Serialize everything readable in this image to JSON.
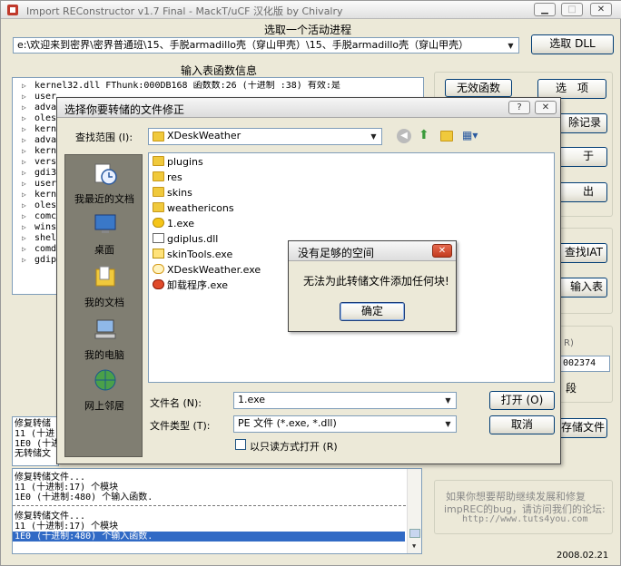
{
  "app": {
    "title": "Import REConstructor v1.7 Final - MackT/uCF 汉化版 by Chivalry",
    "process_label": "选取一个活动进程",
    "process_value": "e:\\欢迎来到密界\\密界普通班\\15、手脱armadillo壳（穿山甲壳）\\15、手脱armadillo壳（穿山甲壳）",
    "select_dll_label": "选取 DLL",
    "imports_label": "输入表函数信息",
    "tree_items": [
      "kernel32.dll FThunk:000DB168 函数数:26 (十进制 :38) 有效:是",
      "user",
      "adva",
      "oles",
      "kern",
      "adva",
      "kern",
      "vers",
      "gdi3",
      "user",
      "kern",
      "oles",
      "comc",
      "wins",
      "shel",
      "comd",
      "gdip"
    ],
    "right_buttons": [
      "无效函数",
      "选　项",
      "除记录",
      "于",
      "出",
      "查找IAT",
      "输入表",
      "存储文件"
    ],
    "side_text_1": "R)",
    "side_value": "002374",
    "side_text_2": "段",
    "log_top": [
      "修复转储",
      "11 (十进",
      "1E0 (十进",
      "无转储文"
    ],
    "log_bottom": [
      "修复转储文件...",
      "11 (十进制:17) 个模块",
      "1E0 (十进制:480) 个输入函数.",
      "",
      "修复转储文件...",
      "11 (十进制:17) 个模块",
      "1E0 (十进制:480) 个输入函数."
    ],
    "footer_text_1": "如果你想要帮助继续发展和修复",
    "footer_text_2": "impREC的bug，请访问我们的论坛:",
    "footer_url": "http://www.tuts4you.com",
    "date": "2008.02.21"
  },
  "dialog": {
    "title": "选择你要转储的文件修正",
    "lookin_label": "查找范围 (I):",
    "lookin_value": "XDeskWeather",
    "places": [
      "我最近的文档",
      "桌面",
      "我的文档",
      "我的电脑",
      "网上邻居"
    ],
    "files": [
      "plugins",
      "res",
      "skins",
      "weathericons",
      "1.exe",
      "gdiplus.dll",
      "skinTools.exe",
      "XDeskWeather.exe",
      "卸载程序.exe"
    ],
    "filename_label": "文件名 (N):",
    "filename_value": "1.exe",
    "filetype_label": "文件类型 (T):",
    "filetype_value": "PE 文件 (*.exe, *.dll)",
    "readonly_label": "以只读方式打开 (R)",
    "open_label": "打开 (O)",
    "cancel_label": "取消"
  },
  "messagebox": {
    "title": "没有足够的空间",
    "message": "无法为此转储文件添加任何块!",
    "ok_label": "确定"
  },
  "colors": {
    "selection": "#316ac5",
    "dialog_border": "#4a4a4a"
  }
}
